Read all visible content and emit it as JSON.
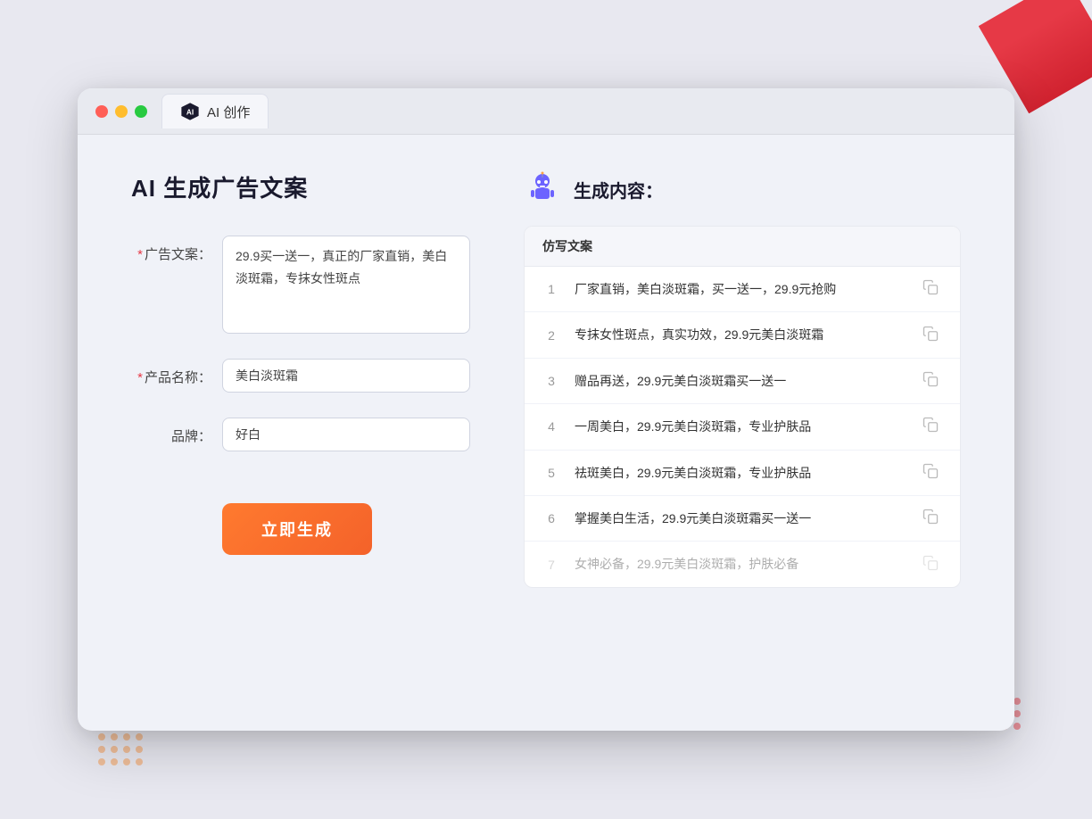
{
  "window": {
    "tab_label": "AI 创作",
    "traffic_lights": [
      "red",
      "yellow",
      "green"
    ]
  },
  "left_panel": {
    "page_title": "AI 生成广告文案",
    "fields": [
      {
        "label": "广告文案：",
        "required": true,
        "type": "textarea",
        "value": "29.9买一送一，真正的厂家直销，美白淡斑霜，专抹女性斑点",
        "name": "ad-copy-input"
      },
      {
        "label": "产品名称：",
        "required": true,
        "type": "input",
        "value": "美白淡斑霜",
        "name": "product-name-input"
      },
      {
        "label": "品牌：",
        "required": false,
        "type": "input",
        "value": "好白",
        "name": "brand-input"
      }
    ],
    "generate_button": "立即生成"
  },
  "right_panel": {
    "title": "生成内容：",
    "table_header": "仿写文案",
    "results": [
      {
        "num": "1",
        "text": "厂家直销，美白淡斑霜，买一送一，29.9元抢购",
        "faded": false
      },
      {
        "num": "2",
        "text": "专抹女性斑点，真实功效，29.9元美白淡斑霜",
        "faded": false
      },
      {
        "num": "3",
        "text": "赠品再送，29.9元美白淡斑霜买一送一",
        "faded": false
      },
      {
        "num": "4",
        "text": "一周美白，29.9元美白淡斑霜，专业护肤品",
        "faded": false
      },
      {
        "num": "5",
        "text": "祛斑美白，29.9元美白淡斑霜，专业护肤品",
        "faded": false
      },
      {
        "num": "6",
        "text": "掌握美白生活，29.9元美白淡斑霜买一送一",
        "faded": false
      },
      {
        "num": "7",
        "text": "女神必备，29.9元美白淡斑霜，护肤必备",
        "faded": true
      }
    ]
  }
}
